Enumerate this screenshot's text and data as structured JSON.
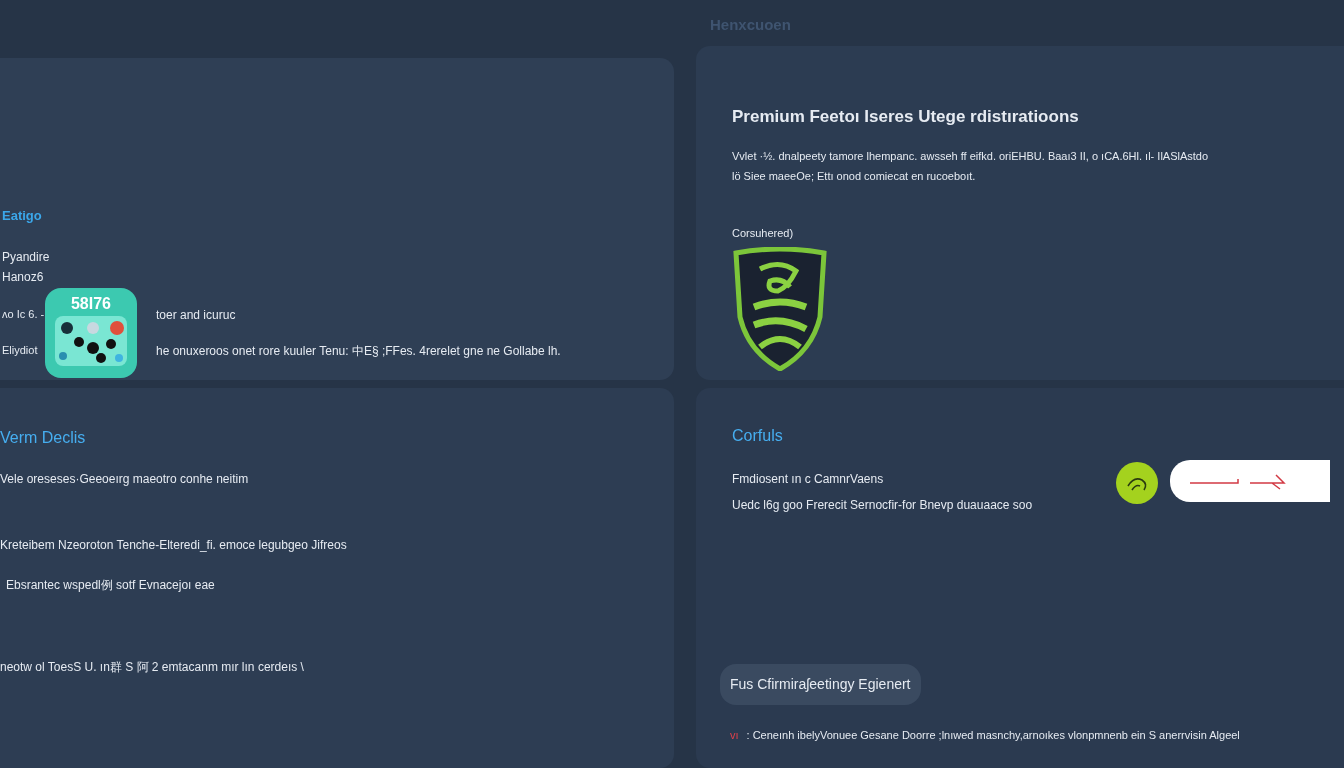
{
  "header": {
    "title": "Henxcuoen"
  },
  "overview_card": {
    "heading": "Eatigo",
    "lines": [
      "Pyandire",
      "Hanoz6"
    ],
    "app_icon": {
      "label": "58I76"
    },
    "rows": [
      {
        "lead": "ʌo Ic 6. -",
        "text": "toer and icuruc"
      },
      {
        "lead": "Eliydiot",
        "text": "he onuxeroos onet rore kuuler Tenu: 中E§ ;FFes. 4rerelet gne ne Gollabe lh."
      }
    ]
  },
  "premium_card": {
    "title": "Premium Feetoı Iseres Utege rdistıratioons",
    "description": [
      "Vvlet ·½. dnalpeety tamore lhempanc. awsseh ff eifkd. oriEHBU. Baaı3 II, o ıCA.6Hl. ıl- IlASlAstdo",
      "lö Siee maeeOe; Ettı onod comiecat en rucoeboıt."
    ],
    "badge_label": "Corsuhered)"
  },
  "terms_card": {
    "heading": "Verm Declis",
    "lines": [
      "Vele oreseses·Geeoeırg maeotro conhe neitim",
      "Kreteibem Nzeoroton Tenche-Elteredi_fi. emoce legubgeo Jifreos",
      "Ebsrantec wspedl例 sotf Evnacejoı eae",
      "neotw ol ToesS U. ın群 S 阿 2 emtacanm mır lın cerdeıs \\"
    ]
  },
  "details_card": {
    "heading": "Corfuls",
    "lines": [
      "Fmdiosent ın c CamnrVaens",
      "Uedc l6g goo Frerecit  Sernocfir-for Bnevp duauaace soo"
    ],
    "pill": {
      "label": "Fus Cfirmiraʃeetingy Egienert"
    },
    "footer": {
      "mark": "vı",
      "text": ":  Ceneınh  ibelyVonuee   Gesane Doorre ;lnıwed masnchy,arnoıkes  vlonpmnenb ein S anerrvisin Algeel"
    }
  }
}
